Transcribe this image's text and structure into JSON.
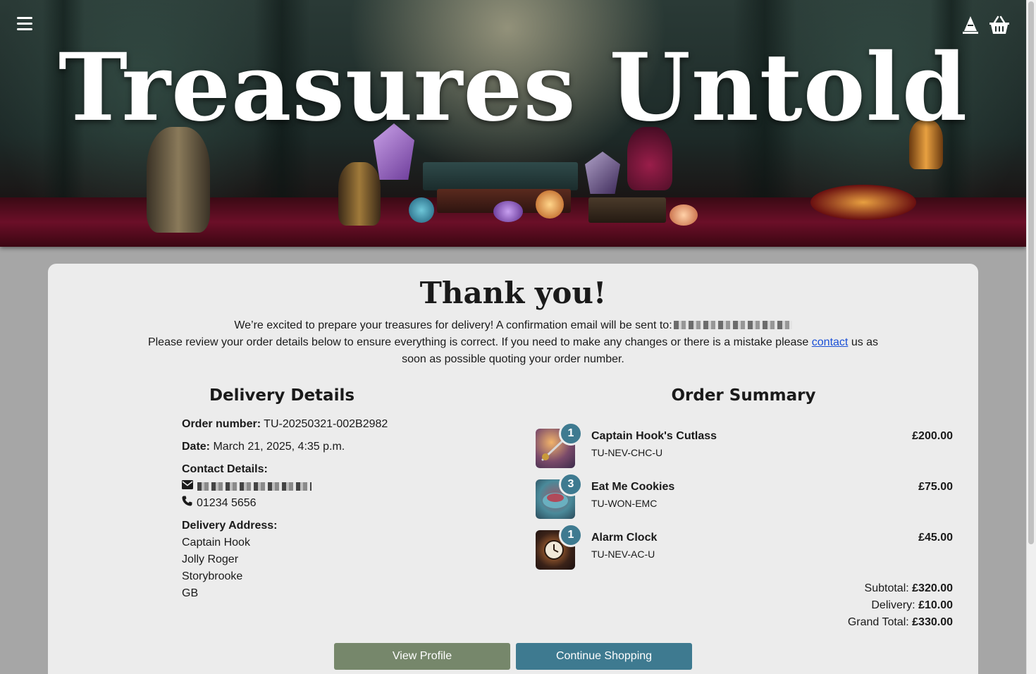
{
  "header": {
    "title": "Treasures Untold",
    "menu_icon": "hamburger-menu-icon",
    "user_icon": "wizard-hat-icon",
    "basket_icon": "basket-icon"
  },
  "confirmation": {
    "title": "Thank you!",
    "line1": "We’re excited to prepare your treasures for delivery! A confirmation email will be sent to:",
    "line2_before_link": "Please review your order details below to ensure everything is correct. If you need to make any changes or there is a mistake please",
    "contact_link": "contact",
    "line2_after_link": "us as soon as possible quoting your order number."
  },
  "delivery": {
    "heading": "Delivery Details",
    "order_label": "Order number:",
    "order_value": "TU-20250321-002B2982",
    "date_label": "Date:",
    "date_value": "March 21, 2025, 4:35 p.m.",
    "contact_label": "Contact Details:",
    "phone": "01234 5656",
    "address_label": "Delivery Address:",
    "address": [
      "Captain Hook",
      "Jolly Roger",
      "Storybrooke",
      "GB"
    ]
  },
  "summary": {
    "heading": "Order Summary",
    "items": [
      {
        "qty": "1",
        "name": "Captain Hook's Cutlass",
        "sku": "TU-NEV-CHC-U",
        "price": "£200.00"
      },
      {
        "qty": "3",
        "name": "Eat Me Cookies",
        "sku": "TU-WON-EMC",
        "price": "£75.00"
      },
      {
        "qty": "1",
        "name": "Alarm Clock",
        "sku": "TU-NEV-AC-U",
        "price": "£45.00"
      }
    ],
    "subtotal_label": "Subtotal:",
    "subtotal": "£320.00",
    "delivery_label": "Delivery:",
    "delivery": "£10.00",
    "grand_label": "Grand Total:",
    "grand": "£330.00"
  },
  "actions": {
    "view_profile": "View Profile",
    "continue_shopping": "Continue Shopping"
  },
  "colors": {
    "primary": "#3e7a90",
    "secondary": "#76876b",
    "card_bg": "#ececec",
    "page_bg": "#a6a6a6"
  }
}
